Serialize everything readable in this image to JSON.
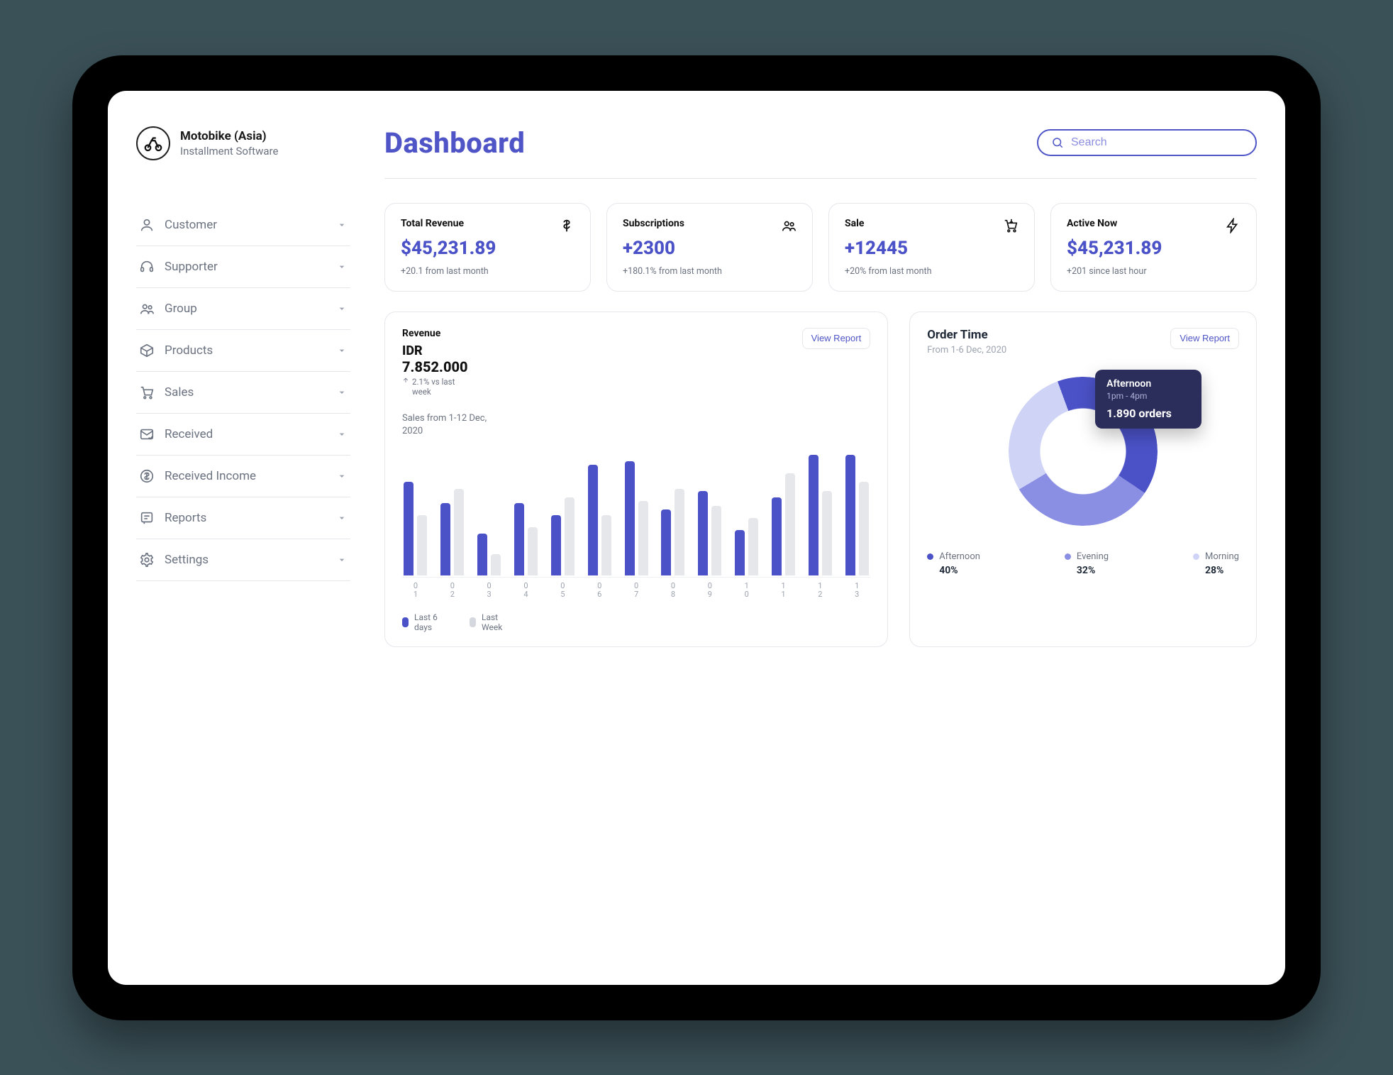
{
  "brand": {
    "name": "Motobike (Asia)",
    "sub": "Installment Software"
  },
  "nav": [
    {
      "label": "Customer"
    },
    {
      "label": "Supporter"
    },
    {
      "label": "Group"
    },
    {
      "label": "Products"
    },
    {
      "label": "Sales"
    },
    {
      "label": "Received"
    },
    {
      "label": "Received Income"
    },
    {
      "label": "Reports"
    },
    {
      "label": "Settings"
    }
  ],
  "page": {
    "title": "Dashboard"
  },
  "search": {
    "placeholder": "Search"
  },
  "stats": [
    {
      "title": "Total Revenue",
      "value": "$45,231.89",
      "sub": "+20.1 from last month"
    },
    {
      "title": "Subscriptions",
      "value": "+2300",
      "sub": "+180.1% from last month"
    },
    {
      "title": "Sale",
      "value": "+12445",
      "sub": "+20% from last month"
    },
    {
      "title": "Active Now",
      "value": "$45,231.89",
      "sub": "+201  since last hour"
    }
  ],
  "revenue": {
    "title": "Revenue",
    "currency": "IDR",
    "amount": "7.852.000",
    "trend": "2.1% vs last week",
    "note": "Sales from 1-12 Dec, 2020",
    "view_btn": "View Report",
    "legend": {
      "primary": "Last 6 days",
      "secondary": "Last Week"
    }
  },
  "order": {
    "title": "Order Time",
    "sub": "From 1-6 Dec, 2020",
    "view_btn": "View Report",
    "tooltip": {
      "title": "Afternoon",
      "range": "1pm - 4pm",
      "value": "1.890 orders"
    },
    "legend": [
      {
        "label": "Afternoon",
        "pct": "40%",
        "color": "#4b52c7"
      },
      {
        "label": "Evening",
        "pct": "32%",
        "color": "#8a8fe3"
      },
      {
        "label": "Morning",
        "pct": "28%",
        "color": "#cfd3f5"
      }
    ]
  },
  "chart_data": {
    "revenue_bars": {
      "type": "bar",
      "categories": [
        "01",
        "02",
        "03",
        "04",
        "05",
        "06",
        "07",
        "08",
        "09",
        "10",
        "11",
        "12"
      ],
      "series": [
        {
          "name": "Last 6 days",
          "values": [
            78,
            60,
            35,
            60,
            50,
            92,
            95,
            55,
            70,
            38,
            65,
            100,
            100
          ]
        },
        {
          "name": "Last Week",
          "values": [
            50,
            72,
            18,
            40,
            65,
            50,
            62,
            72,
            58,
            48,
            85,
            70,
            78
          ]
        }
      ],
      "ylim": [
        0,
        100
      ],
      "note": "Sales from 1-12 Dec, 2020"
    },
    "order_donut": {
      "type": "pie",
      "categories": [
        "Afternoon",
        "Evening",
        "Morning"
      ],
      "values": [
        40,
        32,
        28
      ],
      "title": "Order Time"
    }
  }
}
